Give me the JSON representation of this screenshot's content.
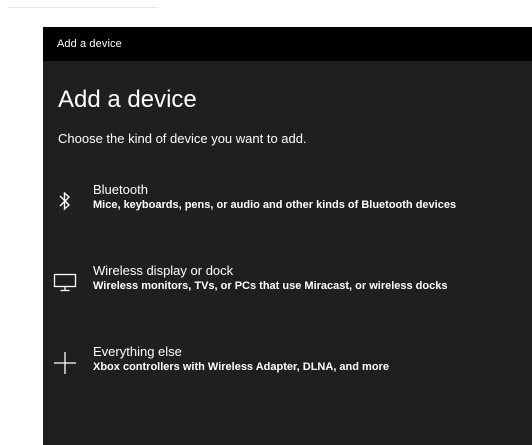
{
  "window": {
    "title": "Add a device"
  },
  "main": {
    "heading": "Add a device",
    "subheading": "Choose the kind of device you want to add."
  },
  "options": [
    {
      "icon": "bluetooth-icon",
      "title": "Bluetooth",
      "description": "Mice, keyboards, pens, or audio and other kinds of Bluetooth devices"
    },
    {
      "icon": "monitor-icon",
      "title": "Wireless display or dock",
      "description": "Wireless monitors, TVs, or PCs that use Miracast, or wireless docks"
    },
    {
      "icon": "plus-icon",
      "title": "Everything else",
      "description": "Xbox controllers with Wireless Adapter, DLNA, and more"
    }
  ],
  "colors": {
    "titlebar": "#000000",
    "background": "#1f1f1f",
    "text": "#ffffff"
  }
}
